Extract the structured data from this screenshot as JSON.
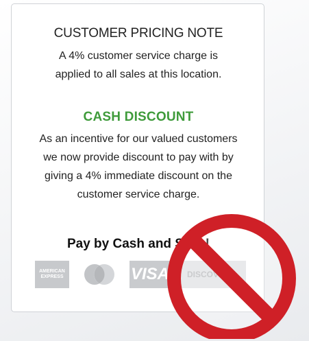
{
  "pricing_note": {
    "title": "CUSTOMER PRICING NOTE",
    "lines": [
      "A 4% customer service charge is",
      "applied to all sales at this location."
    ]
  },
  "cash_discount": {
    "title": "CASH DISCOUNT",
    "lines": [
      "As an incentive for our valued customers",
      "we now provide discount to pay with by",
      "giving a 4% immediate discount on the",
      "customer service charge."
    ]
  },
  "slogan": "Pay by Cash and Save!",
  "card_logos": {
    "amex": [
      "AMERICAN",
      "EXPRESS"
    ],
    "visa": "VISA",
    "discover": "DISCOVER"
  },
  "colors": {
    "accent_green": "#3f9b3b",
    "prohibition_red": "#cf2027"
  },
  "icons": [
    "amex-logo-icon",
    "mastercard-logo-icon",
    "visa-logo-icon",
    "discover-logo-icon",
    "prohibition-sign-icon"
  ]
}
